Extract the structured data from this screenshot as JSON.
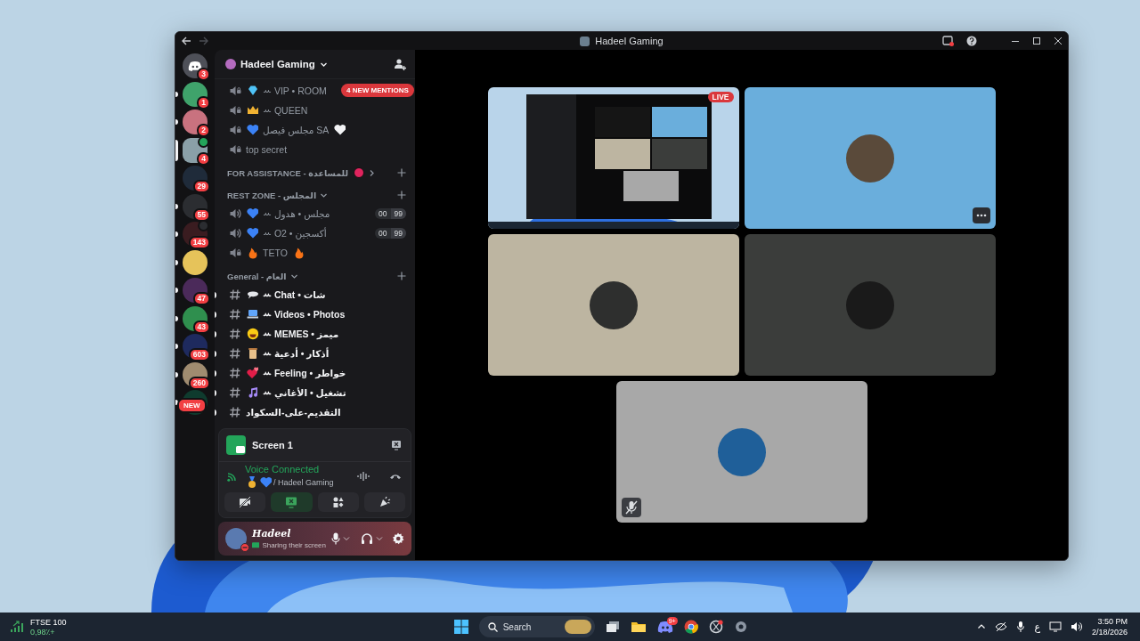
{
  "window": {
    "title": "Hadeel Gaming"
  },
  "servers": [
    {
      "kind": "home",
      "badge": "3",
      "unread": false,
      "selected": false
    },
    {
      "kind": "server",
      "badge": "1",
      "unread": true,
      "selected": false
    },
    {
      "kind": "server",
      "badge": "2",
      "unread": true,
      "selected": false
    },
    {
      "kind": "server",
      "badge": "4",
      "unread": false,
      "selected": true
    },
    {
      "kind": "server",
      "badge": "29",
      "unread": false,
      "selected": false
    },
    {
      "kind": "server",
      "badge": "55",
      "unread": true,
      "selected": false
    },
    {
      "kind": "server",
      "badge": "143",
      "unread": true,
      "selected": false
    },
    {
      "kind": "server",
      "unread": true,
      "selected": false
    },
    {
      "kind": "server",
      "badge": "47",
      "unread": true,
      "selected": false
    },
    {
      "kind": "server",
      "badge": "43",
      "unread": true,
      "selected": false
    },
    {
      "kind": "server",
      "badge": "603",
      "unread": true,
      "selected": false
    },
    {
      "kind": "server",
      "badge": "260",
      "unread": true,
      "selected": false
    },
    {
      "kind": "new",
      "badge": "NEW",
      "unread": true,
      "selected": false
    }
  ],
  "server_header": {
    "name": "Hadeel Gaming",
    "mentions": "4 NEW MENTIONS"
  },
  "channels": [
    {
      "kind": "locked-voice",
      "label": "ꕀ VIP • ROOM"
    },
    {
      "kind": "locked-voice",
      "label": "ꕀ QUEEN"
    },
    {
      "kind": "locked-voice",
      "label": "مجلس فيصل SA"
    },
    {
      "kind": "locked-voice",
      "label": "top secret"
    },
    {
      "kind": "category",
      "label": "FOR ASSISTANCE - للمساعدة",
      "expanded": false
    },
    {
      "kind": "category",
      "label": "REST ZONE - المجلس",
      "expanded": true
    },
    {
      "kind": "voice",
      "label": "ꕀ مجلس • هدول",
      "count": "00",
      "limit": "99"
    },
    {
      "kind": "voice",
      "label": "ꕀ O2 • أكسجين",
      "count": "00",
      "limit": "99"
    },
    {
      "kind": "locked-voice",
      "label": "TETO"
    },
    {
      "kind": "category",
      "label": "General - العام",
      "expanded": true
    },
    {
      "kind": "text",
      "label": "ꕀ Chat • شات",
      "unread": true
    },
    {
      "kind": "text",
      "label": "ꕀ Videos • Photos",
      "unread": true
    },
    {
      "kind": "text",
      "label": "ꕀ MEMES • ميمز",
      "unread": true
    },
    {
      "kind": "text",
      "label": "ꕀ أذكار • أدعية",
      "unread": true
    },
    {
      "kind": "text",
      "label": "ꕀ Feeling • خواطر",
      "unread": true
    },
    {
      "kind": "text",
      "label": "ꕀ تشغيل • الأغاني",
      "unread": true
    },
    {
      "kind": "text",
      "label": "التقديم-على-السكواد",
      "unread": true
    }
  ],
  "stream": {
    "title": "Screen 1"
  },
  "voice": {
    "status": "Voice Connected",
    "channel": "/ Hadeel Gaming"
  },
  "voice_buttons": [
    {
      "kind": "camera",
      "active": false
    },
    {
      "kind": "screen",
      "active": true
    },
    {
      "kind": "activities",
      "active": false
    },
    {
      "kind": "soundboard",
      "active": false
    }
  ],
  "user": {
    "name": "Hadeel",
    "status": "Sharing their screen"
  },
  "tiles": [
    {
      "kind": "stream",
      "badge": "LIVE"
    },
    {
      "kind": "user",
      "color": "#6aaedc",
      "menu": true,
      "muted": false
    },
    {
      "kind": "user",
      "color": "#bdb5a1",
      "menu": false,
      "muted": false
    },
    {
      "kind": "user",
      "color": "#3b3d3b",
      "menu": false,
      "muted": false
    },
    {
      "kind": "user",
      "color": "#a8a8a8",
      "menu": false,
      "muted": true
    }
  ],
  "taskbar": {
    "widget_title": "FTSE 100",
    "widget_value": "0,98٪+",
    "search": "Search",
    "app_badge": "9+",
    "language": "ع",
    "time": "3:50 PM",
    "date": "2/18/2026"
  }
}
